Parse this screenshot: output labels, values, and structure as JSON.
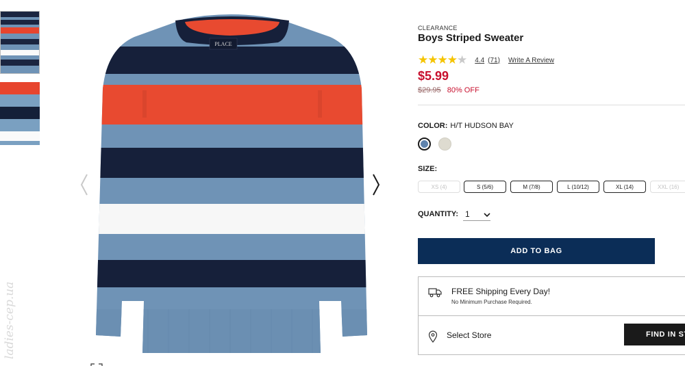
{
  "product": {
    "badge": "CLEARANCE",
    "title": "Boys Striped Sweater",
    "rating_value": "4.4",
    "rating_count": "(71)",
    "write_review": "Write A Review",
    "price": "$5.99",
    "original_price": "$29.95",
    "discount": "80% OFF",
    "image_label": "PLACE"
  },
  "color": {
    "label": "COLOR:",
    "selected": "H/T HUDSON BAY",
    "swatches": [
      "#5f83ad",
      "#dedbd0"
    ]
  },
  "size": {
    "label": "SIZE:",
    "options": [
      "XS (4)",
      "S (5/6)",
      "M (7/8)",
      "L (10/12)",
      "XL (14)",
      "XXL (16)"
    ]
  },
  "quantity": {
    "label": "QUANTITY:",
    "value": "1"
  },
  "actions": {
    "add_to_bag": "ADD TO BAG",
    "find_in_store": "FIND IN STORE"
  },
  "shipping": {
    "title": "FREE Shipping Every Day!",
    "subtitle": "No Minimum Purchase Required.",
    "store_label": "Select Store"
  },
  "watermark": "ladies-cep.ua",
  "colors": {
    "accent_red": "#c8102e",
    "navy_button": "#0b2d57"
  }
}
